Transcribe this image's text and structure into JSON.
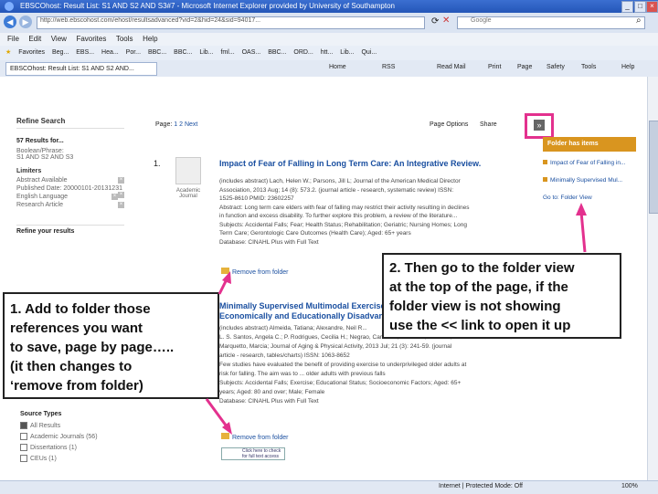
{
  "browser": {
    "window_title": "EBSCOhost: Result List: S1 AND S2 AND S3#7 - Microsoft Internet Explorer provided by University of Southampton",
    "url": "http://web.ebscohost.com/ehost/resultsadvanced?vid=2&hid=24&sid=94017...",
    "search_engine": "Google",
    "menu": [
      "File",
      "Edit",
      "View",
      "Favorites",
      "Tools",
      "Help"
    ],
    "favorites_label": "Favorites",
    "favorites": [
      "Beg...",
      "EBS...",
      "Hea...",
      "Por...",
      "BBC...",
      "BBC...",
      "Lib...",
      "fml...",
      "OAS...",
      "BBC...",
      "ORD...",
      "htt...",
      "Lib...",
      "Qui..."
    ],
    "tab_title": "EBSCOhost: Result List: S1 AND S2 AND...",
    "commands": [
      "Home",
      "RSS",
      "Read Mail",
      "Print",
      "Page",
      "Safety",
      "Tools",
      "Help"
    ],
    "status": [
      "Internet | Protected Mode: Off",
      "100%"
    ]
  },
  "refine": {
    "title": "Refine Search",
    "results_for": "57 Results for...",
    "boolean": "Boolean/Phrase:",
    "boolean_value": "S1 AND S2 AND S3",
    "limiters": "Limiters",
    "limits": [
      "Abstract Available",
      "Published Date: 20000101-20131231",
      "English Language",
      "Research Article"
    ],
    "refine_results": "Refine your results",
    "source_types": "Source Types",
    "sources": [
      "All Results",
      "Academic Journals (56)",
      "Dissertations (1)",
      "CEUs (1)"
    ]
  },
  "results": {
    "page_label": "Page:",
    "pages": [
      "1",
      "2"
    ],
    "next": "Next",
    "page_options": "Page Options",
    "share": "Share",
    "item1": {
      "number": "1.",
      "title": "Impact of Fear of Falling in Long Term Care: An Integrative Review.",
      "type": "Academic Journal",
      "lines": [
        "(includes abstract) Lach, Helen W.; Parsons, Jill L; Journal of the American Medical Director",
        "Association, 2013 Aug; 14 (8): 573.2. (journal article - research, systematic review) ISSN:",
        "1525-8610 PMID: 23602257",
        "Abstract: Long term care elders with fear of falling may restrict their activity resulting in declines",
        "in function and excess disability. To further explore this problem, a review of the literature...",
        "Subjects: Accidental Falls; Fear; Health Status; Rehabilitation; Geriatric; Nursing Homes; Long",
        "Term Care; Gerontologic Care Outcomes (Health Care); Aged: 65+ years",
        "Database: CINAHL Plus with Full Text"
      ],
      "remove": "Remove from folder"
    },
    "item2": {
      "title": "Minimally Supervised Multimodal Exercise to Reduce Falls Risk in Economically and Educationally Disadvantaged...",
      "lines": [
        "(includes abstract) Almeida, Tatiana; Alexandre, Neil R...",
        "L. S. Santos, Angela C.; P. Rodrigues, Cecilia H.; Negrao, Carlos E.; Thomsen, Israel C.;",
        "Marquetto, Marcia; Journal of Aging & Physical Activity, 2013 Jul; 21 (3): 241-59. (journal",
        "article - research, tables/charts) ISSN: 1063-8652",
        "Few studies have evaluated the benefit of providing exercise to underprivileged older adults at",
        "risk for falling. The aim was to ... older adults with previous falls",
        "Subjects: Accidental Falls; Exercise; Educational Status; Socioeconomic Factors; Aged: 65+",
        "years; Aged: 80 and over; Male; Female",
        "Database: CINAHL Plus with Full Text"
      ],
      "remove": "Remove from folder",
      "banner": "Click here to check for full text access"
    }
  },
  "folder": {
    "collapse": "»",
    "header": "Folder has items",
    "items": [
      "Impact of Fear of Falling in...",
      "Minimally Supervised Mul..."
    ],
    "go_to": "Go to: Folder View"
  },
  "callouts": {
    "left": [
      "1. Add to folder those",
      "references you want",
      "to save, page by page…..",
      "(it then changes to",
      "‘remove from folder)"
    ],
    "right": [
      "2. Then go to the  folder view",
      "at the top of the page, if the",
      "folder view is not showing",
      "use the << link to open it up"
    ]
  },
  "colors": {
    "highlight": "#e3318e",
    "folder": "#d9951f",
    "link": "#1a4fa0"
  }
}
